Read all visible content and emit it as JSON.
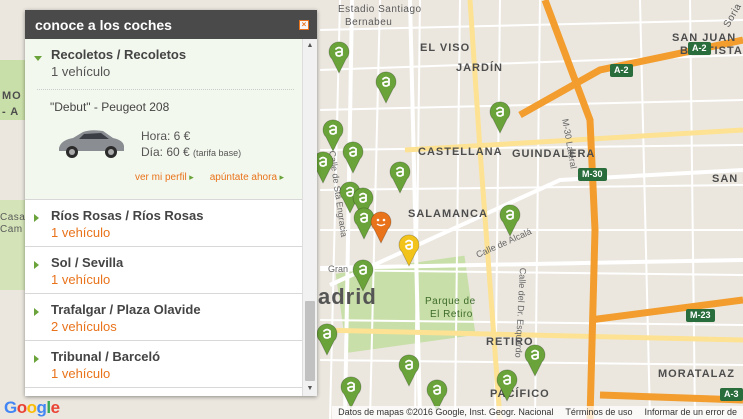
{
  "panel": {
    "title": "conoce a los coches",
    "close_icon": "close-icon",
    "locations": [
      {
        "name": "Recoletos / Recoletos",
        "count": "1 vehículo",
        "expanded": true
      },
      {
        "name": "Ríos Rosas / Ríos Rosas",
        "count": "1 vehículo"
      },
      {
        "name": "Sol / Sevilla",
        "count": "1 vehículo"
      },
      {
        "name": "Trafalgar / Plaza Olavide",
        "count": "2 vehículos"
      },
      {
        "name": "Tribunal / Barceló",
        "count": "1 vehículo"
      }
    ],
    "car": {
      "nickname": "\"Debut\"",
      "model": " - Peugeot 208",
      "hour_price": "Hora: 6 €",
      "day_price": "Día: 60 €",
      "day_note": "(tarifa base)",
      "profile_link": "ver mi perfil",
      "signup_link": "apúntate ahora"
    }
  },
  "map": {
    "labels": {
      "estadio": "Estadio Santiago",
      "bernabeu": "Bernabeu",
      "el_viso": "EL VISO",
      "san_juan": "SAN JUAN",
      "bautista": "BAUTISTA",
      "jardin": "JARDÍN",
      "castellana": "CASTELLANA",
      "guindalera": "GUINDALERA",
      "salamanca": "SALAMANCA",
      "madrid": "adrid",
      "retiro": "RETIRO",
      "parque1": "Parque de",
      "parque2": "El Retiro",
      "pacifico": "PACÍFICO",
      "moratalaz": "MORATALAZ",
      "san_b": "SAN B",
      "soria": "Soria",
      "casa": "Casa",
      "cam": "Cam",
      "sta_engracia": "Calle de Sta Engracia",
      "alcala": "Calle de Alcalá",
      "m30_lateral": "M-30 Lateral",
      "gran": "Gran",
      "esquerdo": "Calle del Dr. Esquerdo",
      "mo": "MO",
      "mo_a": "- A"
    },
    "shields": {
      "a2_top": "A-2",
      "a2": "A-2",
      "m30": "M-30",
      "m23": "M-23",
      "a3": "A-3"
    },
    "attribution": [
      "Datos de mapas ©2016 Google, Inst. Geogr. Nacional",
      "Términos de uso",
      "Informar de un error de"
    ],
    "google": [
      "G",
      "o",
      "o",
      "g",
      "l",
      "e"
    ],
    "colors": {
      "green_pin": "#6aa33a",
      "yellow_pin": "#f2c31b",
      "orange_pin": "#e9731b"
    }
  }
}
